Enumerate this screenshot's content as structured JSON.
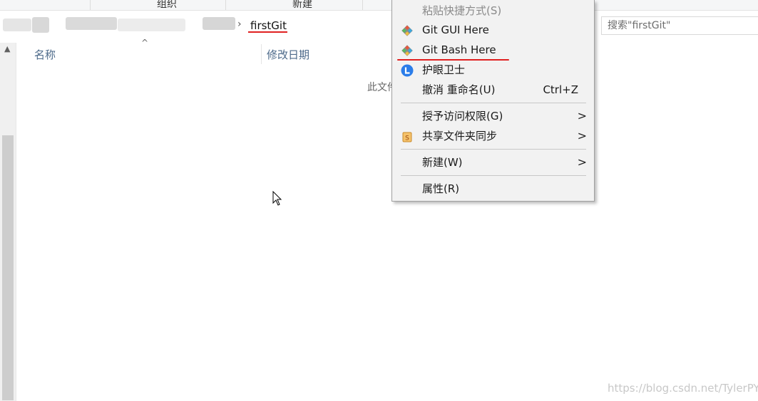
{
  "ribbon": {
    "groups": [
      "组织",
      "新建"
    ]
  },
  "address": {
    "current_folder": "firstGit"
  },
  "search": {
    "placeholder": "搜索\"firstGit\""
  },
  "columns": {
    "name": "名称",
    "modified": "修改日期"
  },
  "content": {
    "empty_text": "此文件"
  },
  "context_menu": {
    "items": [
      {
        "label": "粘贴快捷方式(S)",
        "disabled": true,
        "icon": ""
      },
      {
        "label": "Git GUI Here",
        "icon": "git-icon"
      },
      {
        "label": "Git Bash Here",
        "icon": "git-icon",
        "highlighted": true
      },
      {
        "label": "护眼卫士",
        "icon": "eye-guard-icon"
      },
      {
        "label": "撤消 重命名(U)",
        "shortcut": "Ctrl+Z",
        "icon": ""
      },
      {
        "label": "授予访问权限(G)",
        "submenu": true,
        "icon": ""
      },
      {
        "label": "共享文件夹同步",
        "submenu": true,
        "icon": "sync-folder-icon"
      },
      {
        "label": "新建(W)",
        "submenu": true,
        "icon": ""
      },
      {
        "label": "属性(R)",
        "icon": ""
      }
    ],
    "submenu_glyph": ">"
  },
  "watermark": "https://blog.csdn.net/TylerPY",
  "colors": {
    "highlight_underline": "#e02020",
    "menu_bg": "#f2f2f2",
    "header_text": "#4d6a8a"
  }
}
